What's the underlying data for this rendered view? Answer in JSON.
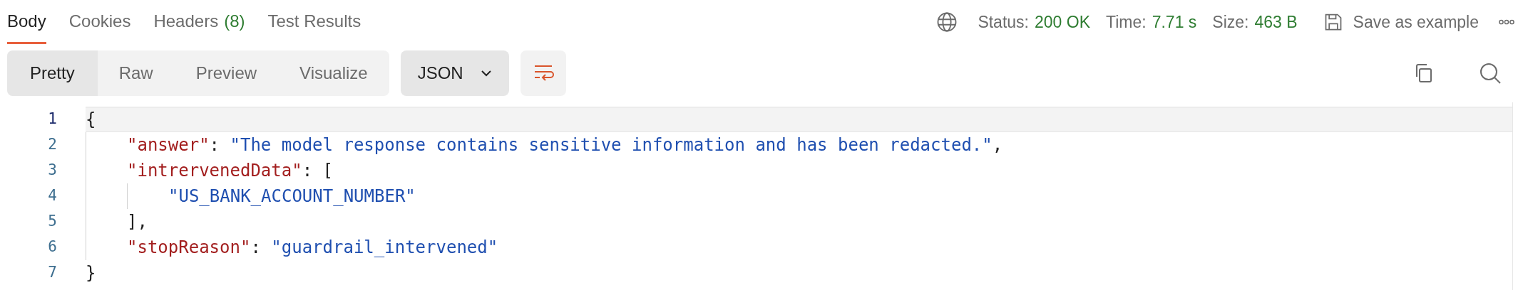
{
  "tabs": [
    {
      "label": "Body",
      "selected": true
    },
    {
      "label": "Cookies",
      "selected": false
    },
    {
      "label": "Headers",
      "count": "(8)",
      "selected": false
    },
    {
      "label": "Test Results",
      "selected": false
    }
  ],
  "response_meta": [
    {
      "label": "Status:",
      "value": "200 OK"
    },
    {
      "label": "Time:",
      "value": "7.71 s"
    },
    {
      "label": "Size:",
      "value": "463 B"
    }
  ],
  "save_button": "Save as example",
  "view_modes": [
    {
      "label": "Pretty",
      "selected": true
    },
    {
      "label": "Raw",
      "selected": false
    },
    {
      "label": "Preview",
      "selected": false
    },
    {
      "label": "Visualize",
      "selected": false
    }
  ],
  "format_dropdown": "JSON",
  "code": [
    {
      "number": "1",
      "current": true,
      "tokens": [
        {
          "kind": "punct",
          "text": "{"
        }
      ]
    },
    {
      "number": "2",
      "current": false,
      "tokens": [
        {
          "kind": "indent"
        },
        {
          "kind": "key",
          "text": "\"answer\""
        },
        {
          "kind": "punct",
          "text": ": "
        },
        {
          "kind": "string",
          "text": "\"The model response contains sensitive information and has been redacted.\""
        },
        {
          "kind": "punct",
          "text": ","
        }
      ]
    },
    {
      "number": "3",
      "current": false,
      "tokens": [
        {
          "kind": "indent"
        },
        {
          "kind": "key",
          "text": "\"intrervenedData\""
        },
        {
          "kind": "punct",
          "text": ": ["
        }
      ]
    },
    {
      "number": "4",
      "current": false,
      "tokens": [
        {
          "kind": "indent"
        },
        {
          "kind": "indent"
        },
        {
          "kind": "string",
          "text": "\"US_BANK_ACCOUNT_NUMBER\""
        }
      ]
    },
    {
      "number": "5",
      "current": false,
      "tokens": [
        {
          "kind": "indent"
        },
        {
          "kind": "punct",
          "text": "],"
        }
      ]
    },
    {
      "number": "6",
      "current": false,
      "tokens": [
        {
          "kind": "indent"
        },
        {
          "kind": "key",
          "text": "\"stopReason\""
        },
        {
          "kind": "punct",
          "text": ": "
        },
        {
          "kind": "string",
          "text": "\"guardrail_intervened\""
        }
      ]
    },
    {
      "number": "7",
      "current": false,
      "tokens": [
        {
          "kind": "punct",
          "text": "}"
        }
      ]
    }
  ]
}
